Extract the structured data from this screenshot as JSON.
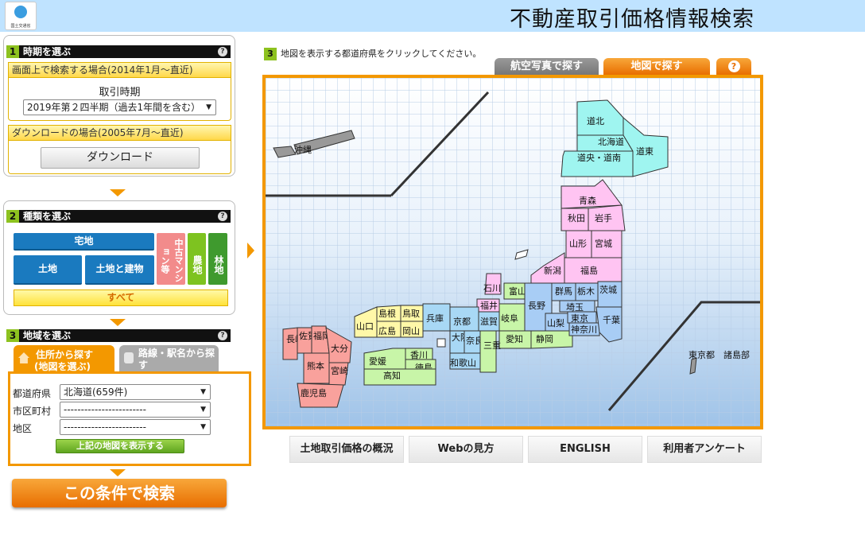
{
  "header": {
    "title": "不動産取引価格情報検索",
    "logo_text": "国土交通省"
  },
  "step1": {
    "num": "1",
    "title": "時期を選ぶ",
    "screen_label": "画面上で検索する場合(2014年1月～直近)",
    "period_label": "取引時期",
    "period_value": "2019年第２四半期（過去1年間を含む）",
    "download_label": "ダウンロードの場合(2005年7月～直近)",
    "download_button": "ダウンロード"
  },
  "step2": {
    "num": "2",
    "title": "種類を選ぶ",
    "takuchi": "宅地",
    "tochi": "土地",
    "tochi_tatemono": "土地と建物",
    "chuko_mansion": "中古マンション等",
    "nochi": "農地",
    "rinchi": "林地",
    "all": "すべて"
  },
  "step3": {
    "num": "3",
    "title": "地域を選ぶ",
    "tab_address_1": "住所から探す",
    "tab_address_2": "(地図を選ぶ)",
    "tab_station": "路線・駅名から探す",
    "pref_label": "都道府県",
    "pref_value": "北海道(659件)",
    "city_label": "市区町村",
    "city_value": "------------------------",
    "district_label": "地区",
    "district_value": "------------------------",
    "show_map_button": "上記の地図を表示する"
  },
  "search_button": "この条件で検索",
  "map_section": {
    "num": "3",
    "instruction": "地図を表示する都道府県をクリックしてください。",
    "tab_aerial": "航空写真で探す",
    "tab_map": "地図で探す",
    "tab_help": "?"
  },
  "prefectures": {
    "okinawa": "沖縄",
    "dohoku": "道北",
    "hokkaido": "北海道",
    "dochuo": "道央・道南",
    "doto": "道東",
    "aomori": "青森",
    "akita": "秋田",
    "iwate": "岩手",
    "yamagata": "山形",
    "miyagi": "宮城",
    "fukushima": "福島",
    "niigata": "新潟",
    "ishikawa": "石川",
    "toyama": "富山",
    "fukui": "福井",
    "nagano": "長野",
    "gunma": "群馬",
    "tochigi": "栃木",
    "ibaraki": "茨城",
    "saitama": "埼玉",
    "tokyo": "東京",
    "kanagawa": "神奈川",
    "chiba": "千葉",
    "yamanashi": "山梨",
    "gifu": "岐阜",
    "shizuoka": "静岡",
    "aichi": "愛知",
    "mie": "三重",
    "shiga": "滋賀",
    "kyoto": "京都",
    "osaka": "大阪",
    "nara": "奈良",
    "wakayama": "和歌山",
    "hyogo": "兵庫",
    "tottori": "鳥取",
    "shimane": "島根",
    "okayama": "岡山",
    "hiroshima": "広島",
    "yamaguchi": "山口",
    "kagawa": "香川",
    "tokushima": "徳島",
    "ehime": "愛媛",
    "kochi": "高知",
    "fukuoka": "福岡",
    "saga": "佐賀",
    "nagasaki": "長崎",
    "oita": "大分",
    "kumamoto": "熊本",
    "miyazaki": "宮崎",
    "kagoshima": "鹿児島",
    "tokyo_islands": "東京都　諸島部"
  },
  "bottom_links": {
    "overview": "土地取引価格の概況",
    "web_howto": "Webの見方",
    "english": "ENGLISH",
    "survey": "利用者アンケート"
  },
  "colors": {
    "accent": "#f39800",
    "blue_button": "#1a7abf",
    "hokkaido": "#9ff5f0",
    "tohoku": "#ffc4f2",
    "kanto": "#a8cdf5",
    "chubu": "#c8f5a8",
    "kinki": "#a8d8f5",
    "chugoku": "#fff8a8",
    "shikoku": "#c8f5a8",
    "kyushu": "#f9a19c"
  }
}
